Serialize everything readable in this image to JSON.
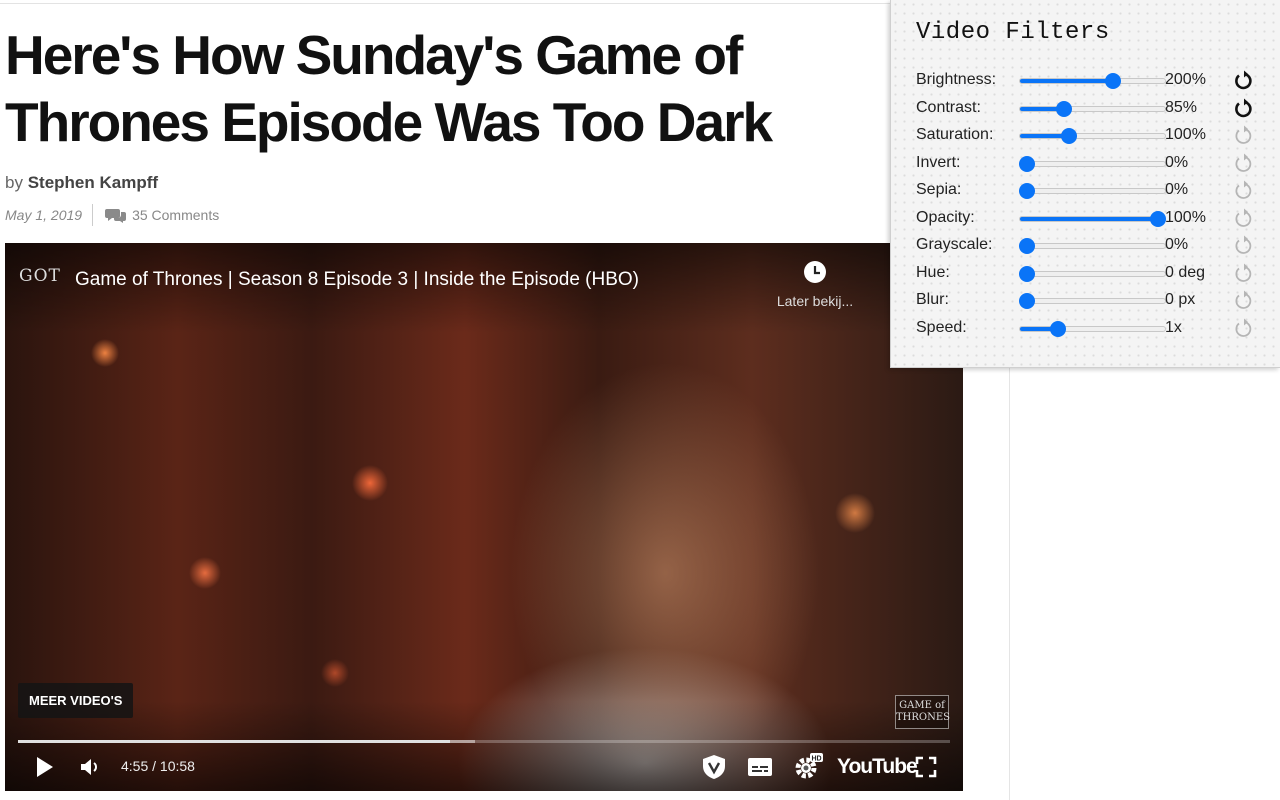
{
  "article": {
    "headline": "Here's How Sunday's Game of Thrones Episode Was Too Dark",
    "by_label": "by",
    "author": "Stephen Kampff",
    "date": "May 1, 2019",
    "comments": "35 Comments"
  },
  "video": {
    "channel_logo": "GOT",
    "title": "Game of Thrones | Season 8 Episode 3 | Inside the Episode (HBO)",
    "watch_later_label": "Later bekij...",
    "more_videos_label": "MEER VIDEO'S",
    "watermark_text": "GAME of THRONES",
    "time_display": "4:55 / 10:58",
    "played_fraction": 0.463,
    "loaded_fraction": 0.49,
    "platform_logo": "YouTube",
    "hd_badge": "HD",
    "icons": [
      "clock-icon",
      "play-icon",
      "volume-icon",
      "shield-icon",
      "subtitles-icon",
      "settings-icon",
      "fullscreen-icon"
    ]
  },
  "filter_panel": {
    "title": "Video Filters",
    "accent_color": "#0a74f7",
    "filters": [
      {
        "label": "Brightness:",
        "value": "200%",
        "level": 0.64,
        "modified": true
      },
      {
        "label": "Contrast:",
        "value": "85%",
        "level": 0.3,
        "modified": true
      },
      {
        "label": "Saturation:",
        "value": "100%",
        "level": 0.34,
        "modified": false
      },
      {
        "label": "Invert:",
        "value": "0%",
        "level": 0.05,
        "modified": false
      },
      {
        "label": "Sepia:",
        "value": "0%",
        "level": 0.05,
        "modified": false
      },
      {
        "label": "Opacity:",
        "value": "100%",
        "level": 0.95,
        "modified": false
      },
      {
        "label": "Grayscale:",
        "value": "0%",
        "level": 0.05,
        "modified": false
      },
      {
        "label": "Hue:",
        "value": "0 deg",
        "level": 0.05,
        "modified": false
      },
      {
        "label": "Blur:",
        "value": "0 px",
        "level": 0.05,
        "modified": false
      },
      {
        "label": "Speed:",
        "value": "1x",
        "level": 0.26,
        "modified": false
      }
    ]
  }
}
